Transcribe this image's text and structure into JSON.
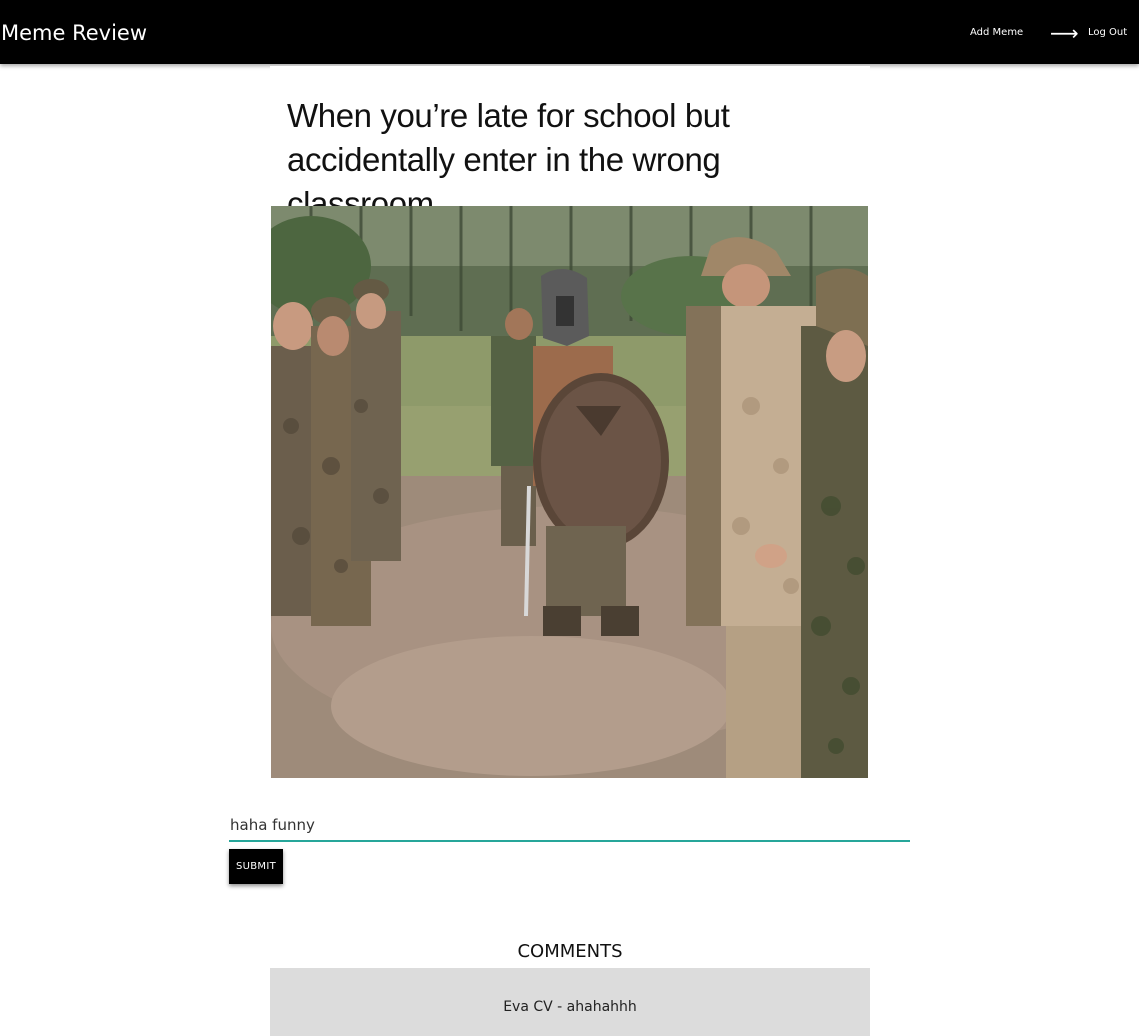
{
  "navbar": {
    "brand": "Meme Review",
    "add_meme_label": "Add Meme",
    "logout_label": "Log Out",
    "logout_icon": "arrow-right-icon",
    "background": "#000000"
  },
  "meme": {
    "caption": "When you’re late for school but accidentally enter in the wrong classroom",
    "image_description_icon": "meme-photo"
  },
  "comment_form": {
    "value": "haha funny",
    "submit_label": "SUBMIT",
    "underline_color": "#26a69a"
  },
  "comments": {
    "title": "COMMENTS",
    "items": [
      {
        "author": "Eva CV",
        "text": "ahahahhh",
        "display": "Eva CV - ahahahhh"
      }
    ]
  }
}
